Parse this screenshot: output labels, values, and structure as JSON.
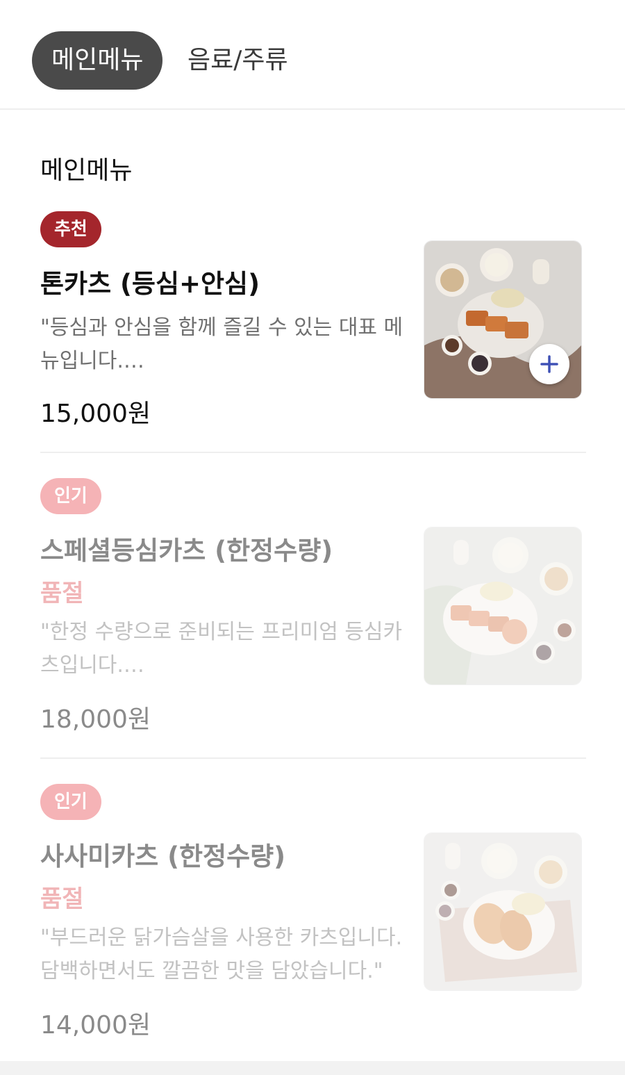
{
  "tabs": [
    {
      "label": "메인메뉴",
      "active": true
    },
    {
      "label": "음료/주류",
      "active": false
    }
  ],
  "section_title": "메인메뉴",
  "items": [
    {
      "badge": "추천",
      "name": "톤카츠 (등심+안심)",
      "status": "",
      "description": "\"등심과 안심을 함께 즐길 수 있는 대표 메뉴입니다.…",
      "price": "15,000원",
      "image_icon": "tonkatsu-set-photo"
    },
    {
      "badge": "인기",
      "name": "스페셜등심카츠 (한정수량)",
      "status": "품절",
      "description": "\"한정 수량으로 준비되는 프리미엄 등심카츠입니다.…",
      "price": "18,000원",
      "image_icon": "loin-katsu-photo"
    },
    {
      "badge": "인기",
      "name": "사사미카츠 (한정수량)",
      "status": "품절",
      "description": "\"부드러운 닭가슴살을 사용한 카츠입니다. 담백하면서도 깔끔한 맛을 담았습니다.\"",
      "price": "14,000원",
      "image_icon": "sasami-katsu-photo"
    }
  ],
  "add_button_icon": "plus-icon",
  "colors": {
    "accent_red": "#a4262c",
    "popular_pink": "#f5b3b6",
    "soldout_pink": "#f1b5b7",
    "plus_icon": "#3f51b5"
  }
}
